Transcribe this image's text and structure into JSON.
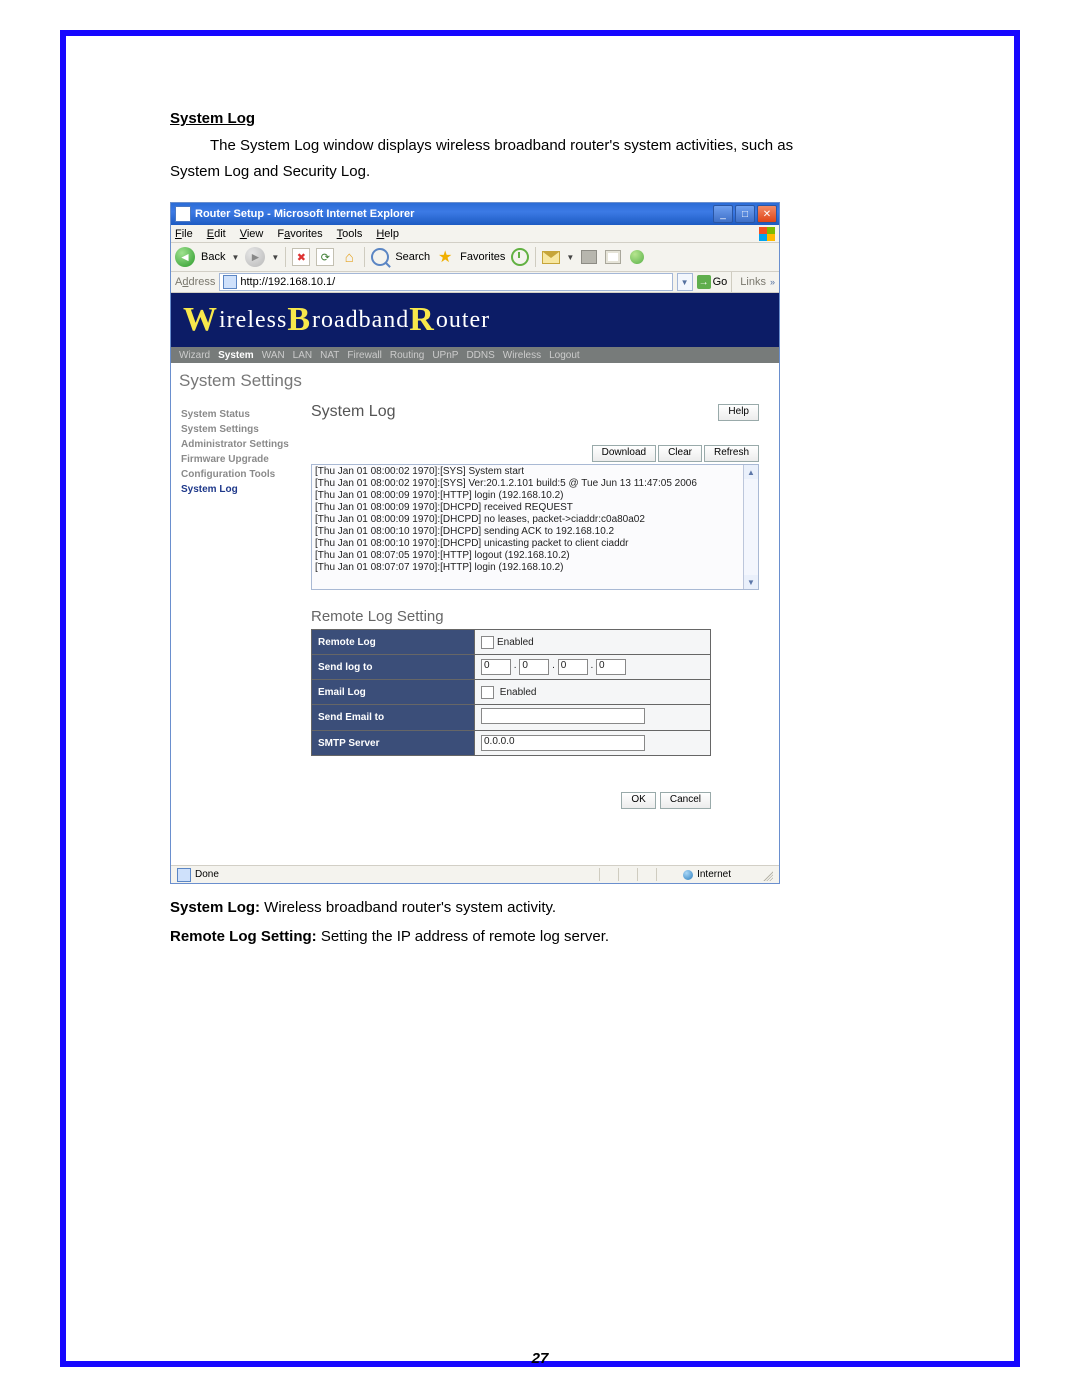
{
  "doc": {
    "heading": "System Log",
    "intro_line1": "The System Log window displays wireless broadband router's system activities, such as",
    "intro_line2": "System Log and Security Log.",
    "post1_label": "System Log:",
    "post1_text": " Wireless broadband router's system activity.",
    "post2_label": "Remote Log Setting:",
    "post2_text": " Setting the IP address of remote log server.",
    "page_number": "27"
  },
  "ie": {
    "title": "Router Setup - Microsoft Internet Explorer",
    "menu": {
      "file": "File",
      "edit": "Edit",
      "view": "View",
      "favorites": "Favorites",
      "tools": "Tools",
      "help": "Help"
    },
    "toolbar": {
      "back": "Back",
      "search": "Search",
      "favorites": "Favorites"
    },
    "addressbar": {
      "label": "Address",
      "url": "http://192.168.10.1/",
      "go": "Go",
      "links": "Links"
    },
    "status": {
      "done": "Done",
      "zone": "Internet"
    }
  },
  "router": {
    "banner": {
      "w": "W",
      "t1": "ireless ",
      "b": "B",
      "t2": "roadband ",
      "r": "R",
      "t3": "outer"
    },
    "nav": [
      "Wizard",
      "System",
      "WAN",
      "LAN",
      "NAT",
      "Firewall",
      "Routing",
      "UPnP",
      "DDNS",
      "Wireless",
      "Logout"
    ],
    "nav_active": "System",
    "settings_title": "System Settings",
    "sidemenu": [
      "System Status",
      "System Settings",
      "Administrator Settings",
      "Firmware Upgrade",
      "Configuration Tools",
      "System Log"
    ],
    "sidemenu_active": "System Log",
    "panel": {
      "title": "System Log",
      "help": "Help",
      "buttons": {
        "download": "Download",
        "clear": "Clear",
        "refresh": "Refresh"
      },
      "log_lines": [
        "[Thu Jan 01 08:00:02 1970]:[SYS] System start",
        "[Thu Jan 01 08:00:02 1970]:[SYS] Ver:20.1.2.101 build:5 @ Tue Jun 13 11:47:05 2006",
        "[Thu Jan 01 08:00:09 1970]:[HTTP] login (192.168.10.2)",
        "[Thu Jan 01 08:00:09 1970]:[DHCPD] received REQUEST",
        "[Thu Jan 01 08:00:09 1970]:[DHCPD] no leases, packet->ciaddr:c0a80a02",
        "[Thu Jan 01 08:00:10 1970]:[DHCPD] sending ACK to 192.168.10.2",
        "[Thu Jan 01 08:00:10 1970]:[DHCPD] unicasting packet to client ciaddr",
        "[Thu Jan 01 08:07:05 1970]:[HTTP] logout (192.168.10.2)",
        "[Thu Jan 01 08:07:07 1970]:[HTTP] login (192.168.10.2)"
      ],
      "remote_title": "Remote Log Setting",
      "rows": {
        "remote_log": "Remote Log",
        "send_log_to": "Send log to",
        "email_log": "Email Log",
        "send_email_to": "Send Email to",
        "smtp_server": "SMTP Server"
      },
      "values": {
        "enabled": "Enabled",
        "ip": [
          "0",
          "0",
          "0",
          "0"
        ],
        "email": "",
        "smtp": "0.0.0.0"
      },
      "ok": "OK",
      "cancel": "Cancel"
    }
  }
}
